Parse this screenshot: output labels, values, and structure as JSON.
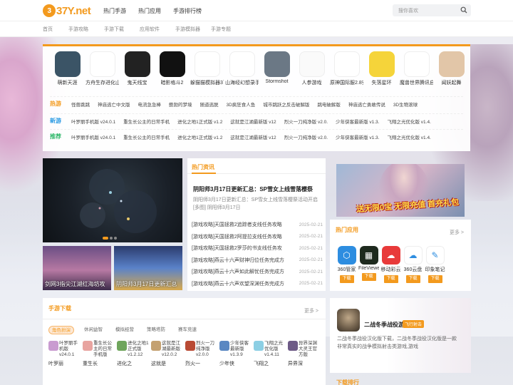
{
  "brand": {
    "logo_mark": "3",
    "logo_text": "37Y.net",
    "accent": "#f39a1e"
  },
  "topnav": [
    "热门手游",
    "热门应用",
    "手游排行榜"
  ],
  "search": {
    "placeholder": "搜你喜欢",
    "icon": "search-icon"
  },
  "subnav": [
    "首页",
    "手游攻略",
    "手游下载",
    "应用软件",
    "手游模拟器",
    "手游专题"
  ],
  "featured_apps": [
    {
      "name": "萌新天涯",
      "extra": "",
      "color": "#3b5466"
    },
    {
      "name": "方舟生存进化山海经奇魔进化",
      "extra": "",
      "color": "#ffffff"
    },
    {
      "name": "鬼天线宝",
      "extra": "",
      "color": "#222222"
    },
    {
      "name": "暗影格斗2",
      "extra": "",
      "color": "#111111"
    },
    {
      "name": "躲猫猫模拟器3下载安装官方正版",
      "extra": "",
      "color": "#ffffff"
    },
    {
      "name": "山海经幻想录手游官方正式版",
      "extra": "",
      "color": "#ffffff"
    },
    {
      "name": "Stormshot",
      "extra": "",
      "color": "#6b7885"
    },
    {
      "name": "人参游戏",
      "extra": "",
      "color": "#fafafa"
    },
    {
      "name": "原神国际服2.8安装包最新版",
      "extra": "",
      "color": "#ffffff"
    },
    {
      "name": "失落星环",
      "extra": "",
      "color": "#f5d43a"
    },
    {
      "name": "魔兽世界腾讯自远征怀旧服手游",
      "extra": "",
      "color": "#ffffff"
    },
    {
      "name": "闻妖起舞",
      "extra": "",
      "color": "#e2c6a8"
    }
  ],
  "tag_rows": [
    {
      "label": "热游",
      "label_color": "#f39a1e",
      "items": [
        "怪兽跳跳",
        "神庙逃亡中文版",
        "电流急急棒",
        "鲍勃的梦境",
        "随道逃脱",
        "3D疯狂食人鱼",
        "城市跳跃之反击破解版",
        "跳电破解版",
        "神庙逃亡勇敢传说",
        "3D生物滚球"
      ]
    },
    {
      "label": "新游",
      "label_color": "#2a9ae3",
      "items": [
        "叶罗丽手机版 v24.0.1",
        "重生长公主的日常手机",
        "进化之地1正式版 v1.2",
        "这就是江湖最新版 v12",
        "烈火一刀纯净版 v2.0.",
        "少年侠客最新版 v1.3.",
        "飞翔之光优化版 v1.4."
      ]
    },
    {
      "label": "推荐",
      "label_color": "#2fb86a",
      "items": [
        "叶罗丽手机版 v24.0.1",
        "重生长公主的日常手机",
        "进化之地1正式版 v1.2",
        "这就是江湖最新版 v12",
        "烈火一刀纯净版 v2.0.",
        "少年侠客最新版 v1.3.",
        "飞翔之光优化版 v1.4."
      ]
    }
  ],
  "thumbs": [
    {
      "caption": "剑网3指尖江湖红海坊攻"
    },
    {
      "caption": "阴阳师3月17日更新汇总"
    }
  ],
  "news": {
    "header": "热门资讯",
    "headline": "阴阳师3月17日更新汇总：SP雪女上线雪落樱祭",
    "summary": "阴阳师3月17日更新汇总：SP雪女上线雪落樱祭活动开启[多图] 阴阳师3月17日",
    "items": [
      {
        "title": "[游戏攻略]天国拯救2追踪者支线任务攻略",
        "date": "2025-02-21"
      },
      {
        "title": "[游戏攻略]天国拯救2阿提拉支线任务攻略",
        "date": "2025-02-21"
      },
      {
        "title": "[游戏攻略]天国拯救2罗莎的书支线任务攻",
        "date": "2025-02-21"
      },
      {
        "title": "[游戏攻略]燕云十六声财神归位任务完成方",
        "date": "2025-02-21"
      },
      {
        "title": "[游戏攻略]燕云十六声如此解忧任务完成方",
        "date": "2025-02-21"
      },
      {
        "title": "[游戏攻略]燕云十六声欢望深渊任务完成方",
        "date": "2025-02-21"
      }
    ]
  },
  "ad": {
    "text": "送无限0宝 无限充值 首充礼包"
  },
  "hot_apps": {
    "header": "热门应用",
    "more": "更多 >",
    "download_label": "下载",
    "items": [
      {
        "name": "360管家",
        "color": "#2d8de0",
        "glyph": "⬡"
      },
      {
        "name": "FileViewer",
        "color": "#1e2a1e",
        "glyph": "▦"
      },
      {
        "name": "移动彩云",
        "color": "#e83a3a",
        "glyph": "☁"
      },
      {
        "name": "360云盘",
        "color": "#ffffff",
        "glyph": "☁"
      },
      {
        "name": "印象笔记",
        "color": "#ffffff",
        "glyph": "✎"
      }
    ]
  },
  "downloads": {
    "header": "手游下载",
    "more": "更多 >",
    "categories": [
      "角色扮演",
      "休闲益智",
      "模拟经营",
      "策略塔防",
      "赛车竞速"
    ],
    "games": [
      {
        "desc": "叶罗丽手机版v24.0.1",
        "name": "叶罗丽",
        "color": "#c99bd0"
      },
      {
        "desc": "重生长公主的日常手机版",
        "name": "重生长",
        "color": "#e8a4a0"
      },
      {
        "desc": "进化之地1正式版v1.2.12",
        "name": "进化之",
        "color": "#6fa55c"
      },
      {
        "desc": "这就是江湖最新版v12.0.2",
        "name": "这就是",
        "color": "#c4a171"
      },
      {
        "desc": "烈火一刀纯净版v2.0.0",
        "name": "烈火一",
        "color": "#b94a34"
      },
      {
        "desc": "少年侠客最新版v1.3.9",
        "name": "少年侠",
        "color": "#5a87c2"
      },
      {
        "desc": "飞翔之光优化版v1.4.11",
        "name": "飞翔之",
        "color": "#8ccfe4"
      },
      {
        "desc": "异界深渊大灵王官方版",
        "name": "异界深",
        "color": "#6d5a86"
      }
    ]
  },
  "promo": {
    "title": "二战冬季战役游",
    "tag": "飞行射击",
    "desc": "二战冬季战役汉化版下载，二战冬季战役汉化版是一款非常真实的战争模拟射击类游戏,游戏"
  },
  "bottom_header": "下载排行"
}
